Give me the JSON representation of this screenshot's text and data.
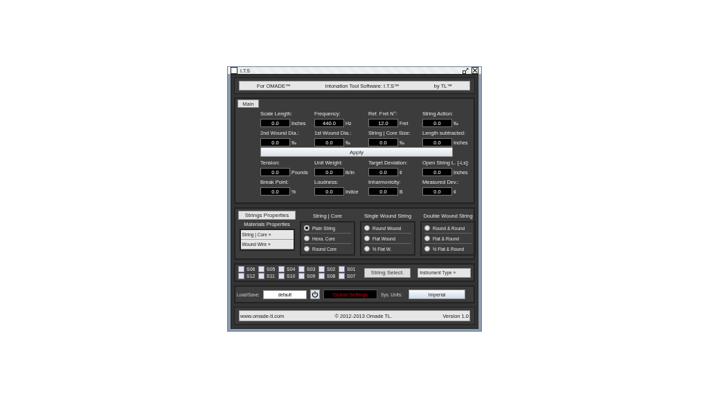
{
  "window": {
    "title": "I.T.S"
  },
  "header": [
    "For OMADE™",
    "Intonation Tool Software: I.T.S™",
    "by TL™"
  ],
  "main_tab": {
    "label": "Main",
    "selected": true
  },
  "fields_top": [
    {
      "label": "Scale Length:",
      "value": "0.0",
      "unit": "Inches"
    },
    {
      "label": "Frequency:",
      "value": "440.0",
      "unit": "Hz"
    },
    {
      "label": "Ref. Fret N°:",
      "value": "12.0",
      "unit": "Fret"
    },
    {
      "label": "String Action:",
      "value": "0.0",
      "unit": "‰"
    },
    {
      "label": "2nd Wound Dia.:",
      "value": "0.0",
      "unit": "‰"
    },
    {
      "label": "1st Wound Dia.:",
      "value": "0.0",
      "unit": "‰"
    },
    {
      "label": "String | Core Size:",
      "value": "0.0",
      "unit": "‰"
    },
    {
      "label": "Length subtracted:",
      "value": "0.0",
      "unit": "Inches"
    }
  ],
  "apply_button": "Apply",
  "fields_bottom": [
    {
      "label": "Tension:",
      "value": "0.0",
      "unit": "Pounds"
    },
    {
      "label": "Unit Weight:",
      "value": "0.0",
      "unit": "lb/in"
    },
    {
      "label": "Target Deviation:",
      "value": "0.0",
      "unit": "¢"
    },
    {
      "label": "Open String L. [-Ls]:",
      "value": "0.0",
      "unit": "Inches"
    },
    {
      "label": "Break Point:",
      "value": "0.0",
      "unit": "%"
    },
    {
      "label": "Loudness:",
      "value": "0.0",
      "unit": "Indice"
    },
    {
      "label": "Inharmonicity:",
      "value": "0.0",
      "unit": "B"
    },
    {
      "label": "Measured Dev.:",
      "value": "0.0",
      "unit": "¢"
    }
  ],
  "strings_properties_button": "Strings Properties",
  "materials": {
    "title": "Materials Properties",
    "items": [
      "String | Core »",
      "Wound Wire »"
    ]
  },
  "radio_groups": [
    {
      "title": "String | Core",
      "options": [
        {
          "label": "Plain String",
          "selected": true
        },
        {
          "label": "Hexa. Core",
          "selected": false
        },
        {
          "label": "Round Core",
          "selected": false
        }
      ]
    },
    {
      "title": "Single Wound String",
      "options": [
        {
          "label": "Round Wound",
          "selected": false
        },
        {
          "label": "Flat Wound",
          "selected": false
        },
        {
          "label": "½ Flat W.",
          "selected": false
        }
      ]
    },
    {
      "title": "Double Wound String",
      "options": [
        {
          "label": "Round & Round",
          "selected": false
        },
        {
          "label": "Flat & Round",
          "selected": false
        },
        {
          "label": "½ Flat & Round",
          "selected": false
        }
      ]
    }
  ],
  "string_checkboxes": [
    {
      "label": "S06",
      "checked": false
    },
    {
      "label": "S05",
      "checked": false
    },
    {
      "label": "S04",
      "checked": false
    },
    {
      "label": "S03",
      "checked": false
    },
    {
      "label": "S02",
      "checked": false
    },
    {
      "label": "S01",
      "checked": false
    },
    {
      "label": "S12",
      "checked": false
    },
    {
      "label": "S11",
      "checked": false
    },
    {
      "label": "S10",
      "checked": false
    },
    {
      "label": "S09",
      "checked": false
    },
    {
      "label": "S08",
      "checked": false
    },
    {
      "label": "S07",
      "checked": false
    }
  ],
  "string_select_button": "String Select.",
  "instrument_type_button": "Instrument Type »",
  "load_save": {
    "label": "Load/Save:",
    "value": "default"
  },
  "global_settings": "Global Settings",
  "sys_units": {
    "label": "Sys. Units:",
    "value": "Imperial"
  },
  "footer": {
    "website": "www.omade-tl.com",
    "copyright": "© 2012-2013 Omade TL.",
    "version": "Version 1.0"
  }
}
